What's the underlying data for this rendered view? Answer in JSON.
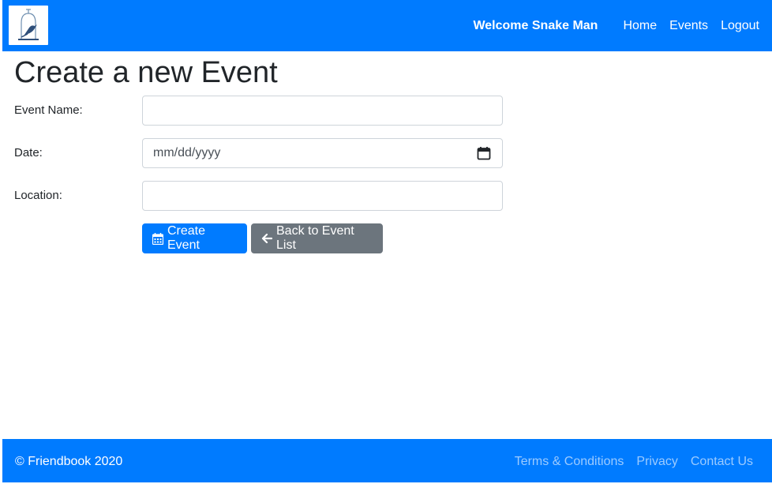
{
  "colors": {
    "primary": "#007bff",
    "secondary": "#6c757d",
    "footer_link": "#9ccbff"
  },
  "navbar": {
    "logo_icon": "bird-in-cage-icon",
    "welcome": "Welcome Snake Man",
    "links": [
      "Home",
      "Events",
      "Logout"
    ]
  },
  "page": {
    "title": "Create a new Event"
  },
  "form": {
    "event_name": {
      "label": "Event Name:",
      "value": ""
    },
    "date": {
      "label": "Date:",
      "placeholder": "mm/dd/yyyy",
      "icon": "calendar-icon"
    },
    "location": {
      "label": "Location:",
      "value": ""
    },
    "create_button": {
      "label": "Create Event",
      "icon": "calendar-icon"
    },
    "back_button": {
      "label": "Back to Event List",
      "icon": "arrow-left-icon"
    }
  },
  "footer": {
    "copyright": "© Friendbook 2020",
    "links": [
      "Terms & Conditions",
      "Privacy",
      "Contact Us"
    ]
  }
}
